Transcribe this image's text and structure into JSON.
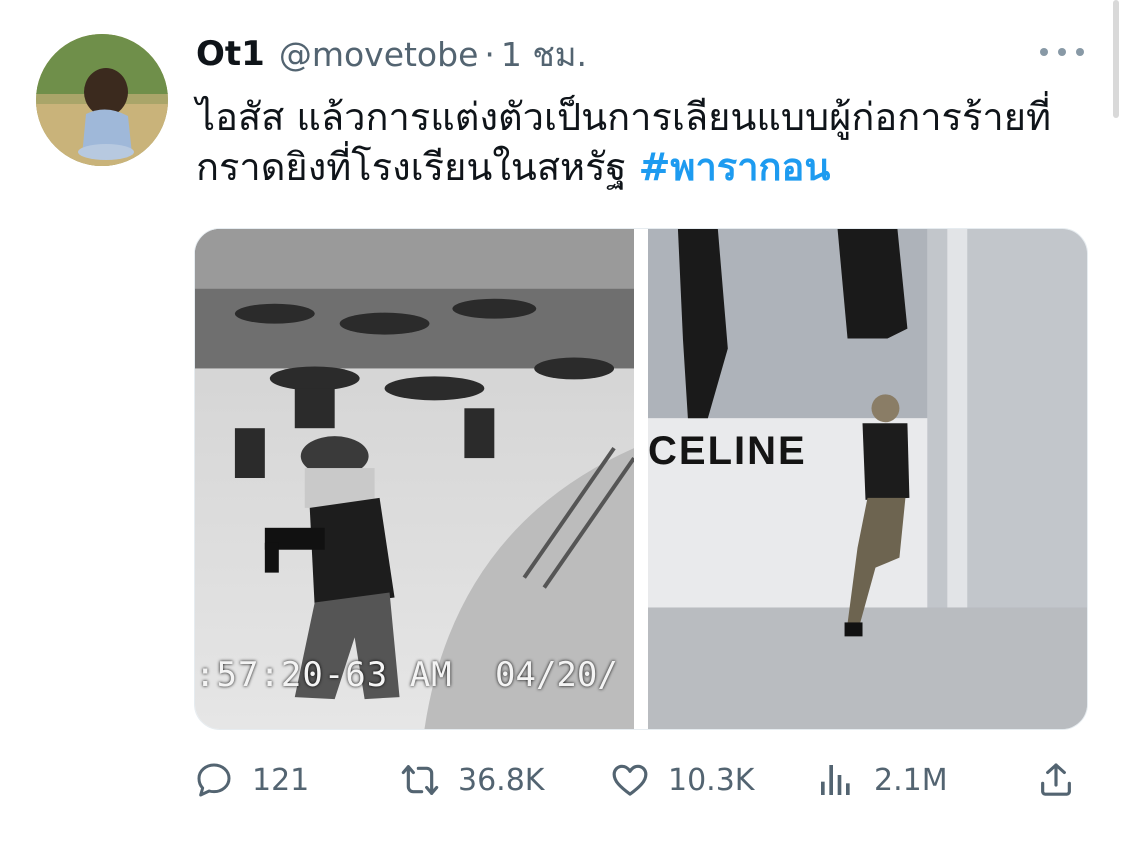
{
  "tweet": {
    "display_name": "Ot1",
    "handle": "@movetobe",
    "separator": "·",
    "time": "1 ชม.",
    "text_main": "ไอสัส แล้วการแต่งตัวเป็นการเลียนแบบผู้ก่อการร้ายที่กราดยิงที่โรงเรียนในสหรัฐ ",
    "hashtag": "#พารากอน",
    "accent_color": "#1d9bf0"
  },
  "media": {
    "left_photo": {
      "timestamp_overlay": ":57:20-63 AM",
      "date_overlay": "04/20/"
    },
    "right_photo": {
      "sign_text": "CELINE"
    }
  },
  "actions": {
    "reply": {
      "icon": "reply-icon",
      "count": "121"
    },
    "retweet": {
      "icon": "retweet-icon",
      "count": "36.8K"
    },
    "like": {
      "icon": "heart-icon",
      "count": "10.3K"
    },
    "views": {
      "icon": "views-icon",
      "count": "2.1M"
    },
    "share": {
      "icon": "share-icon"
    }
  }
}
